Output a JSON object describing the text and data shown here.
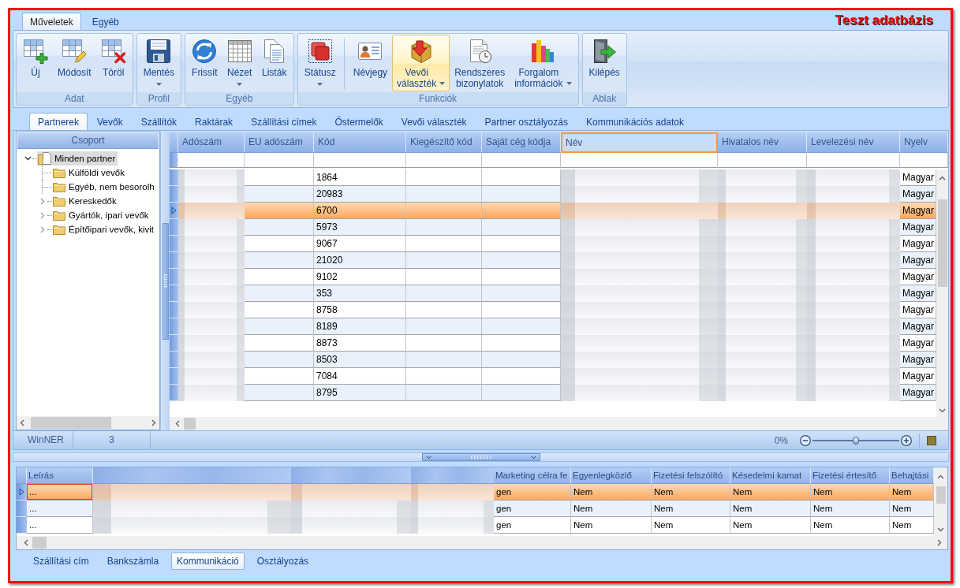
{
  "window": {
    "title": "Teszt adatbázis"
  },
  "ribbon": {
    "tabs": [
      {
        "label": "Műveletek",
        "selected": true
      },
      {
        "label": "Egyéb",
        "selected": false
      }
    ],
    "groups": [
      {
        "label": "Adat",
        "buttons": [
          {
            "label": "Új",
            "kind": "new",
            "dropdown": false,
            "active": false,
            "separator": false
          },
          {
            "label": "Módosít",
            "kind": "edit",
            "dropdown": false,
            "active": false,
            "separator": false
          },
          {
            "label": "Töröl",
            "kind": "delete",
            "dropdown": false,
            "active": false,
            "separator": false
          }
        ]
      },
      {
        "label": "Profil",
        "buttons": [
          {
            "label": "Mentés",
            "kind": "save",
            "dropdown": true,
            "active": false,
            "separator": false
          }
        ]
      },
      {
        "label": "Egyéb",
        "buttons": [
          {
            "label": "Frissít",
            "kind": "refresh",
            "dropdown": false,
            "active": false,
            "separator": false
          },
          {
            "label": "Nézet",
            "kind": "view",
            "dropdown": true,
            "active": false,
            "separator": false
          },
          {
            "label": "Listák",
            "kind": "lists",
            "dropdown": false,
            "active": false,
            "separator": false
          }
        ]
      },
      {
        "label": "Funkciók",
        "buttons": [
          {
            "label": "Státusz",
            "kind": "status",
            "dropdown": true,
            "active": false,
            "separator": false
          },
          {
            "label": "Névjegy",
            "kind": "contact",
            "dropdown": false,
            "active": false,
            "separator": true
          },
          {
            "label": "Vevői választék",
            "kind": "selection",
            "dropdown": true,
            "active": true,
            "separator": false
          },
          {
            "label": "Rendszeres bizonylatok",
            "kind": "documents",
            "dropdown": false,
            "active": false,
            "separator": false
          },
          {
            "label": "Forgalom információk",
            "kind": "statistics",
            "dropdown": true,
            "active": false,
            "separator": false
          }
        ]
      },
      {
        "label": "Ablak",
        "buttons": [
          {
            "label": "Kilépés",
            "kind": "exit",
            "dropdown": false,
            "active": false,
            "separator": false
          }
        ]
      }
    ]
  },
  "tabs": [
    {
      "label": "Partnerek",
      "selected": true
    },
    {
      "label": "Vevők",
      "selected": false
    },
    {
      "label": "Szállítók",
      "selected": false
    },
    {
      "label": "Raktárak",
      "selected": false
    },
    {
      "label": "Szállítási címek",
      "selected": false
    },
    {
      "label": "Őstermelők",
      "selected": false
    },
    {
      "label": "Vevői választék",
      "selected": false
    },
    {
      "label": "Partner osztályozás",
      "selected": false
    },
    {
      "label": "Kommunikációs adatok",
      "selected": false
    }
  ],
  "tree": {
    "header": "Csoport",
    "items": [
      {
        "label": "Minden partner",
        "selected": true,
        "expanded": true,
        "children": [
          {
            "label": "Külföldi vevők",
            "selected": false
          },
          {
            "label": "Egyéb, nem besorolh",
            "selected": false
          },
          {
            "label": "Kereskedők",
            "selected": false,
            "expanded": false
          },
          {
            "label": "Gyártók, ipari vevők",
            "selected": false,
            "expanded": false
          },
          {
            "label": "Építőipari vevők, kivit",
            "selected": false,
            "expanded": false
          }
        ]
      }
    ]
  },
  "grid": {
    "columns": [
      {
        "label": "Adószám",
        "kind": "blurred",
        "selected": false
      },
      {
        "label": "EU adószám",
        "kind": "text",
        "selected": false
      },
      {
        "label": "Kód",
        "kind": "text",
        "selected": false
      },
      {
        "label": "Kiegészítő kód",
        "kind": "text",
        "selected": false
      },
      {
        "label": "Saját cég kódja",
        "kind": "text",
        "selected": false
      },
      {
        "label": "Név",
        "kind": "blurred",
        "selected": true
      },
      {
        "label": "Hivatalos név",
        "kind": "blurred",
        "selected": false
      },
      {
        "label": "Levelezési név",
        "kind": "blurred",
        "selected": false
      },
      {
        "label": "Nyelv",
        "kind": "text",
        "selected": false
      }
    ],
    "rows": [
      {
        "cells": [
          "",
          "",
          "1864",
          "",
          "",
          "",
          "",
          "",
          "Magyar"
        ],
        "selected": false
      },
      {
        "cells": [
          "",
          "",
          "20983",
          "",
          "",
          "",
          "",
          "",
          "Magyar"
        ],
        "selected": false
      },
      {
        "cells": [
          "",
          "",
          "6700",
          "",
          "",
          "",
          "",
          "",
          "Magyar"
        ],
        "selected": true
      },
      {
        "cells": [
          "",
          "",
          "5973",
          "",
          "",
          "",
          "",
          "",
          "Magyar"
        ],
        "selected": false
      },
      {
        "cells": [
          "",
          "",
          "9067",
          "",
          "",
          "",
          "",
          "",
          "Magyar"
        ],
        "selected": false
      },
      {
        "cells": [
          "",
          "",
          "21020",
          "",
          "",
          "",
          "",
          "",
          "Magyar"
        ],
        "selected": false
      },
      {
        "cells": [
          "",
          "",
          "9102",
          "",
          "",
          "",
          "",
          "",
          "Magyar"
        ],
        "selected": false
      },
      {
        "cells": [
          "",
          "",
          "353",
          "",
          "",
          "",
          "",
          "",
          "Magyar"
        ],
        "selected": false
      },
      {
        "cells": [
          "",
          "",
          "8758",
          "",
          "",
          "",
          "",
          "",
          "Magyar"
        ],
        "selected": false
      },
      {
        "cells": [
          "",
          "",
          "8189",
          "",
          "",
          "",
          "",
          "",
          "Magyar"
        ],
        "selected": false
      },
      {
        "cells": [
          "",
          "",
          "8873",
          "",
          "",
          "",
          "",
          "",
          "Magyar"
        ],
        "selected": false
      },
      {
        "cells": [
          "",
          "",
          "8503",
          "",
          "",
          "",
          "",
          "",
          "Magyar"
        ],
        "selected": false
      },
      {
        "cells": [
          "",
          "",
          "7084",
          "",
          "",
          "",
          "",
          "",
          "Magyar"
        ],
        "selected": false
      },
      {
        "cells": [
          "",
          "",
          "8795",
          "",
          "",
          "",
          "",
          "",
          "Magyar"
        ],
        "selected": false
      }
    ]
  },
  "status_bar": {
    "app": "WinNER",
    "count": "3",
    "zoom": {
      "reading": "0%",
      "level": 0.5
    }
  },
  "detail_grid": {
    "columns": [
      {
        "label": "Leírás",
        "kind": "text"
      },
      {
        "kind": "blurred"
      },
      {
        "kind": "blurred"
      },
      {
        "kind": "blurred"
      },
      {
        "label": "Marketing célra fe",
        "kind": "text"
      },
      {
        "label": "Egyenlegközlő",
        "kind": "text"
      },
      {
        "label": "Fizetési felszólító",
        "kind": "text"
      },
      {
        "label": "Késedelmi kamat",
        "kind": "text"
      },
      {
        "label": "Fizetési értesítő",
        "kind": "text"
      },
      {
        "label": "Behajtási",
        "kind": "text"
      }
    ],
    "rows": [
      {
        "cells": [
          "...",
          "",
          "",
          "",
          "gen",
          "Nem",
          "Nem",
          "Nem",
          "Nem",
          "Nem"
        ],
        "selected": true
      },
      {
        "cells": [
          "...",
          "",
          "",
          "",
          "gen",
          "Nem",
          "Nem",
          "Nem",
          "Nem",
          "Nem"
        ],
        "selected": false
      },
      {
        "cells": [
          "...",
          "",
          "",
          "",
          "gen",
          "Nem",
          "Nem",
          "Nem",
          "Nem",
          "Nem"
        ],
        "selected": false
      }
    ]
  },
  "detail_tabs": [
    {
      "label": "Szállítási cím",
      "selected": false
    },
    {
      "label": "Bankszámla",
      "selected": false
    },
    {
      "label": "Kommunikáció",
      "selected": true
    },
    {
      "label": "Osztályozás",
      "selected": false
    }
  ]
}
